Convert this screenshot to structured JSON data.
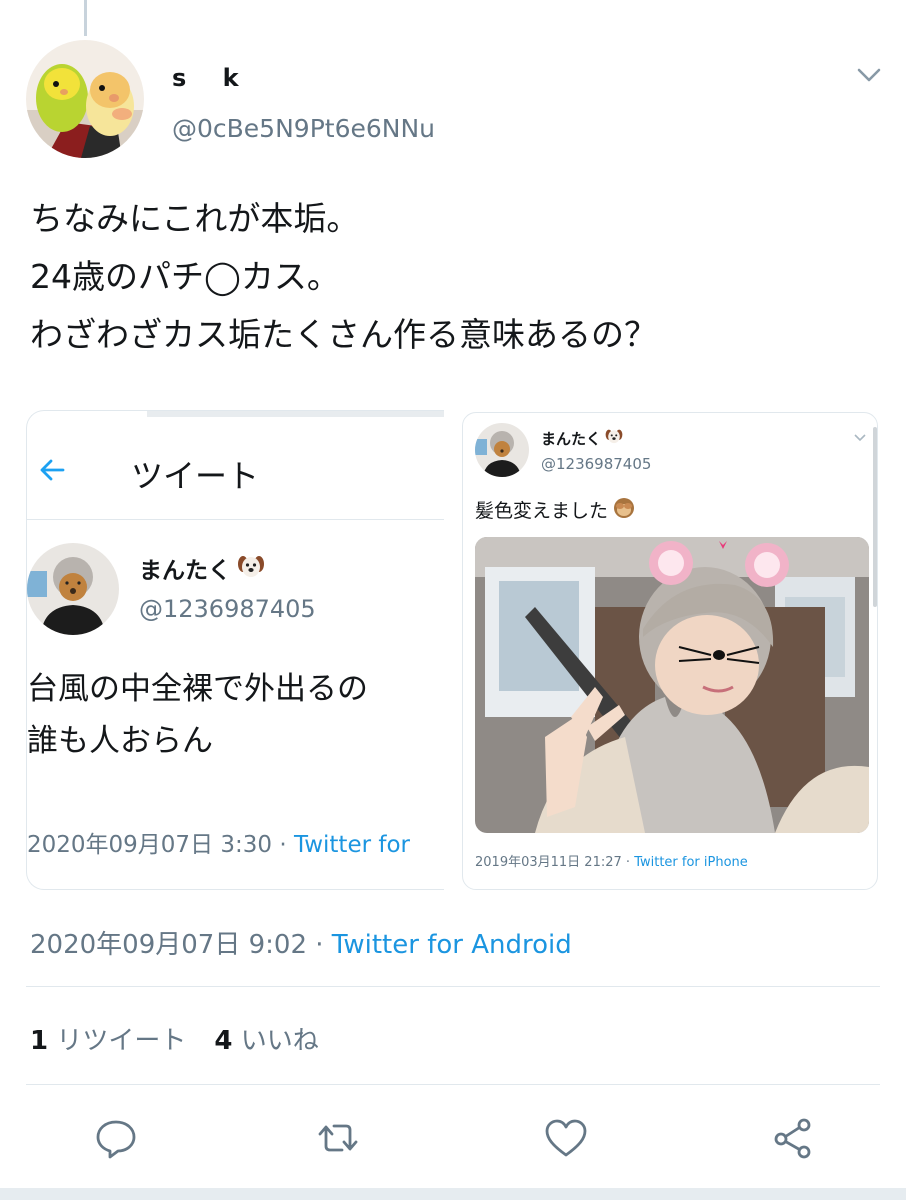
{
  "tweet": {
    "display_name": "s k",
    "handle": "@0cBe5N9Pt6e6NNu",
    "text_lines": [
      "ちなみにこれが本垢。",
      "24歳のパチ◯カス。",
      "わざわざカス垢たくさん作る意味あるの？"
    ],
    "timestamp": "2020年09月07日 9:02",
    "separator": "·",
    "source": "Twitter for Android",
    "retweet_count": "1",
    "retweet_label": "リツイート",
    "like_count": "4",
    "like_label": "いいね"
  },
  "quoted_left": {
    "header_title": "ツイート",
    "name": "まんたく",
    "handle": "@1236987405",
    "text_lines": [
      "台風の中全裸で外出るの",
      "",
      "誰も人おらん"
    ],
    "timestamp": "2020年09月07日 3:30",
    "separator": "·",
    "source": "Twitter for"
  },
  "quoted_right": {
    "name": "まんたく",
    "handle": "@1236987405",
    "text": "髪色変えました",
    "timestamp": "2019年03月11日 21:27",
    "separator": "·",
    "source": "Twitter for iPhone"
  },
  "icons": {
    "caret": "chevron-down-icon",
    "back": "arrow-left-icon",
    "reply": "reply-icon",
    "retweet": "retweet-icon",
    "like": "heart-icon",
    "share": "share-icon"
  },
  "colors": {
    "link": "#1b95e0",
    "secondary_text": "#657786",
    "icon": "#657786",
    "divider": "#e1e8ed"
  }
}
